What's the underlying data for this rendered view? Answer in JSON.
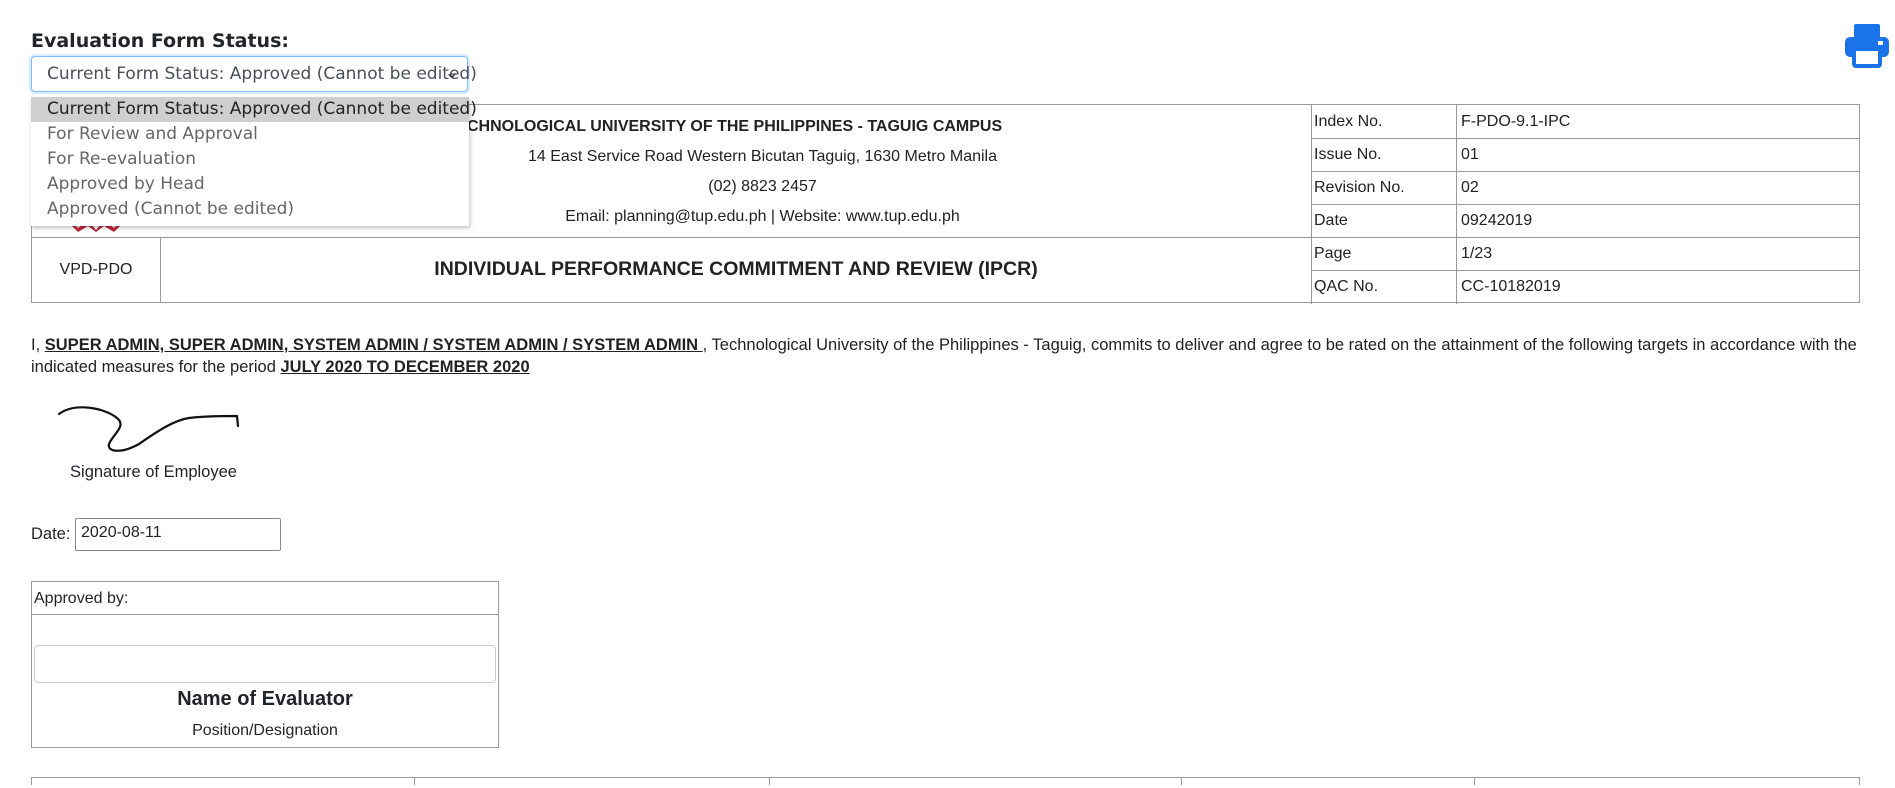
{
  "status": {
    "label": "Evaluation Form Status:",
    "selected": "Current Form Status: Approved (Cannot be edited)",
    "options": [
      "Current Form Status: Approved (Cannot be edited)",
      "For Review and Approval",
      "For Re-evaluation",
      "Approved by Head",
      "Approved (Cannot be edited)"
    ]
  },
  "header": {
    "university": "CHNOLOGICAL UNIVERSITY OF THE PHILIPPINES - TAGUIG CAMPUS",
    "address": "14 East Service Road Western Bicutan Taguig, 1630 Metro Manila",
    "phone": "(02) 8823 2457",
    "contact": "Email: planning@tup.edu.ph | Website: www.tup.edu.ph",
    "office": "VPD-PDO",
    "form_title": "INDIVIDUAL PERFORMANCE COMMITMENT AND REVIEW (IPCR)",
    "meta": [
      {
        "label": "Index No.",
        "value": "F-PDO-9.1-IPC"
      },
      {
        "label": "Issue No.",
        "value": "01"
      },
      {
        "label": "Revision No.",
        "value": "02"
      },
      {
        "label": "Date",
        "value": "09242019"
      },
      {
        "label": "Page",
        "value": "1/23"
      },
      {
        "label": "QAC No.",
        "value": "CC-10182019"
      }
    ]
  },
  "commitment": {
    "prefix": "I, ",
    "name": "SUPER ADMIN, SUPER ADMIN, SYSTEM ADMIN / SYSTEM ADMIN / SYSTEM ADMIN ",
    "middle": ", Technological University of the Philippines - Taguig, commits to deliver and agree to be rated on the attainment of the following targets in accordance with the indicated measures for the period ",
    "period": "JULY 2020 TO DECEMBER 2020"
  },
  "signature": {
    "label": "Signature of Employee"
  },
  "date": {
    "label": "Date:",
    "value": "2020-08-11"
  },
  "approval": {
    "label": "Approved by:",
    "evaluator_value": "",
    "evaluator_name": "Name of Evaluator",
    "position": "Position/Designation"
  },
  "icons": {
    "print": "print-icon",
    "chevron": "chevron-down-icon"
  },
  "colors": {
    "accent": "#007bff",
    "logo_red": "#c0283c",
    "selected_option_bg": "#cfcfcf"
  }
}
